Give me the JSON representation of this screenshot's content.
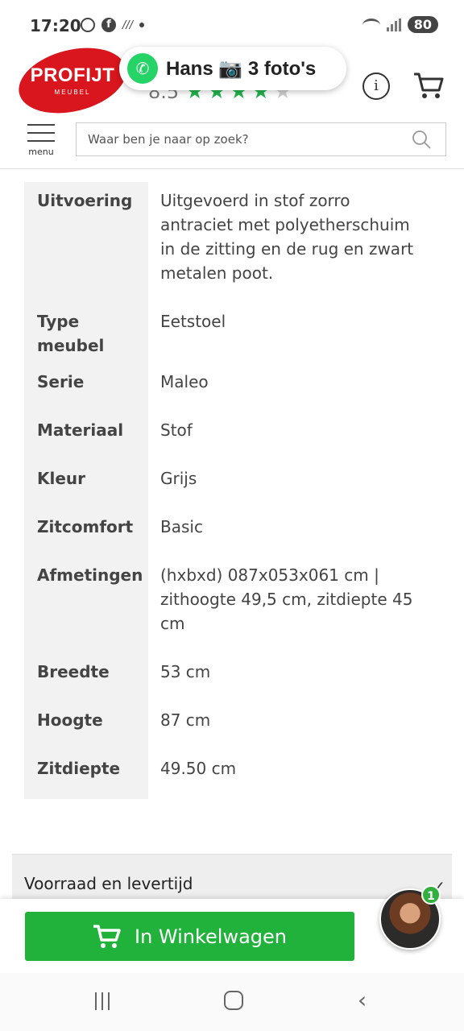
{
  "status_bar": {
    "time": "17:20",
    "battery": "80",
    "misc_small": "///"
  },
  "header": {
    "logo_text": "PROFIJT",
    "logo_sub": "MEUBEL",
    "rating_score": "8.5",
    "stars_full": 4,
    "stars_total": 5,
    "whatsapp_notice": "Hans 📷 3 foto's",
    "info_symbol": "i"
  },
  "search": {
    "menu_label": "menu",
    "placeholder": "Waar ben je naar op zoek?"
  },
  "specs": [
    {
      "label": "Uitvoering",
      "value": "Uitgevoerd in stof zorro antraciet met polyetherschuim in de zitting en de rug en zwart metalen poot."
    },
    {
      "label": "Type meubel",
      "value": "Eetstoel"
    },
    {
      "label": "Serie",
      "value": "Maleo"
    },
    {
      "label": "Materiaal",
      "value": "Stof"
    },
    {
      "label": "Kleur",
      "value": "Grijs"
    },
    {
      "label": "Zitcomfort",
      "value": "Basic"
    },
    {
      "label": "Afmetingen",
      "value": "(hxbxd) 087x053x061 cm | zithoogte 49,5 cm, zitdiepte 45 cm"
    },
    {
      "label": "Breedte",
      "value": "53 cm"
    },
    {
      "label": "Hoogte",
      "value": "87 cm"
    },
    {
      "label": "Zitdiepte",
      "value": "49.50 cm"
    }
  ],
  "accordion": {
    "title": "Voorraad en levertijd"
  },
  "cart_button": {
    "label": "In Winkelwagen"
  },
  "chat": {
    "badge_count": "1"
  },
  "colors": {
    "brand_red": "#d9161d",
    "cart_green": "#21b23c",
    "star_green": "#22b24c",
    "whatsapp_green": "#25d366"
  }
}
